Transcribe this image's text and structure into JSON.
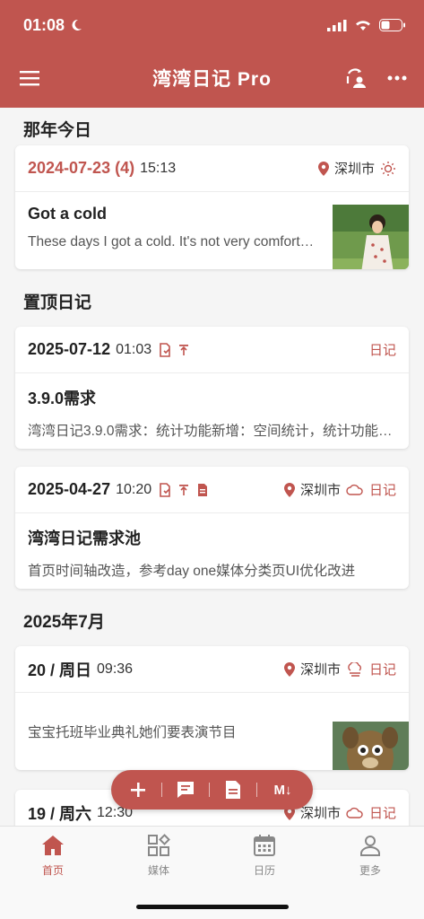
{
  "status_bar": {
    "time": "01:08"
  },
  "nav": {
    "title": "湾湾日记 Pro"
  },
  "sections": {
    "on_this_day": "那年今日",
    "pinned": "置顶日记",
    "month": "2025年7月"
  },
  "entries": [
    {
      "date": "2024-07-23 (4)",
      "time": "15:13",
      "location": "深圳市",
      "title": "Got a cold",
      "text": "These days I got a cold. It's not very comfortable..."
    },
    {
      "date": "2025-07-12",
      "time": "01:03",
      "tag": "日记",
      "title": "3.9.0需求",
      "text": "湾湾日记3.9.0需求：统计功能新增：空间统计，统计功能新增"
    },
    {
      "date": "2025-04-27",
      "time": "10:20",
      "location": "深圳市",
      "tag": "日记",
      "title": "湾湾日记需求池",
      "text": "首页时间轴改造，参考day one媒体分类页UI优化改进"
    },
    {
      "date": "20 / 周日",
      "time": "09:36",
      "location": "深圳市",
      "tag": "日记",
      "text": "宝宝托班毕业典礼她们要表演节目"
    },
    {
      "date": "19 / 周六",
      "time": "12:30",
      "location": "深圳市",
      "tag": "日记"
    }
  ],
  "fab": {
    "md_label": "M↓"
  },
  "tabs": [
    {
      "label": "首页"
    },
    {
      "label": "媒体"
    },
    {
      "label": "日历"
    },
    {
      "label": "更多"
    }
  ],
  "colors": {
    "brand": "#c0554f",
    "tab_inactive": "#888888"
  },
  "icons": [
    "menu-icon",
    "sync-icon",
    "more-icon",
    "location-icon",
    "sun-icon",
    "cloud-icon",
    "fog-icon",
    "document-icon",
    "pin-icon",
    "note-icon",
    "plus-icon",
    "chat-icon",
    "markdown-icon",
    "home-icon",
    "grid-icon",
    "calendar-icon",
    "user-icon"
  ]
}
